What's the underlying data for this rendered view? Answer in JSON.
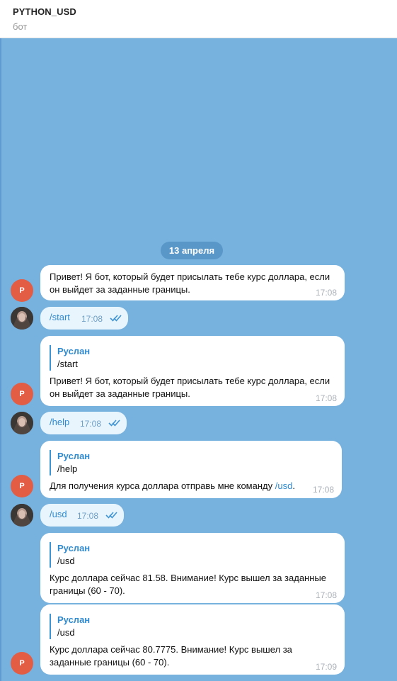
{
  "header": {
    "title": "PYTHON_USD",
    "subtitle": "бот"
  },
  "date_separator": "13 апреля",
  "bot_avatar_letter": "P",
  "user_avatar_icon": "user-photo-avatar",
  "messages": [
    {
      "type": "incoming",
      "text_line1": "Привет! Я бот, который будет присылать тебе курс доллара, если",
      "text_line2": "он выйдет за заданные границы.",
      "time": "17:08"
    },
    {
      "type": "outgoing",
      "text": "/start",
      "time": "17:08"
    },
    {
      "type": "incoming",
      "reply_name": "Руслан",
      "reply_text": "/start",
      "text_line1": "Привет! Я бот, который будет присылать тебе курс доллара, если",
      "text_line2": "он выйдет за заданные границы.",
      "time": "17:08"
    },
    {
      "type": "outgoing",
      "text": "/help",
      "time": "17:08"
    },
    {
      "type": "incoming",
      "reply_name": "Руслан",
      "reply_text": "/help",
      "text_before_link": "Для получения курса доллара отправь мне команду ",
      "link": "/usd",
      "text_after_link": ".",
      "time": "17:08"
    },
    {
      "type": "outgoing",
      "text": "/usd",
      "time": "17:08"
    },
    {
      "type": "incoming",
      "reply_name": "Руслан",
      "reply_text": "/usd",
      "text_line1": "Курс доллара сейчас 81.58. Внимание! Курс вышел за заданные",
      "text_line2": "границы (60 - 70).",
      "time": "17:08"
    },
    {
      "type": "incoming",
      "reply_name": "Руслан",
      "reply_text": "/usd",
      "text_line1": "Курс доллара сейчас 80.7775. Внимание! Курс вышел за",
      "text_line2": "заданные границы (60 - 70).",
      "time": "17:09"
    }
  ],
  "colors": {
    "chat_background": "#77b1de",
    "bubble_in": "#ffffff",
    "bubble_out": "#e9f5fd",
    "accent": "#2f8ad0",
    "bot_avatar": "#e35d45"
  }
}
